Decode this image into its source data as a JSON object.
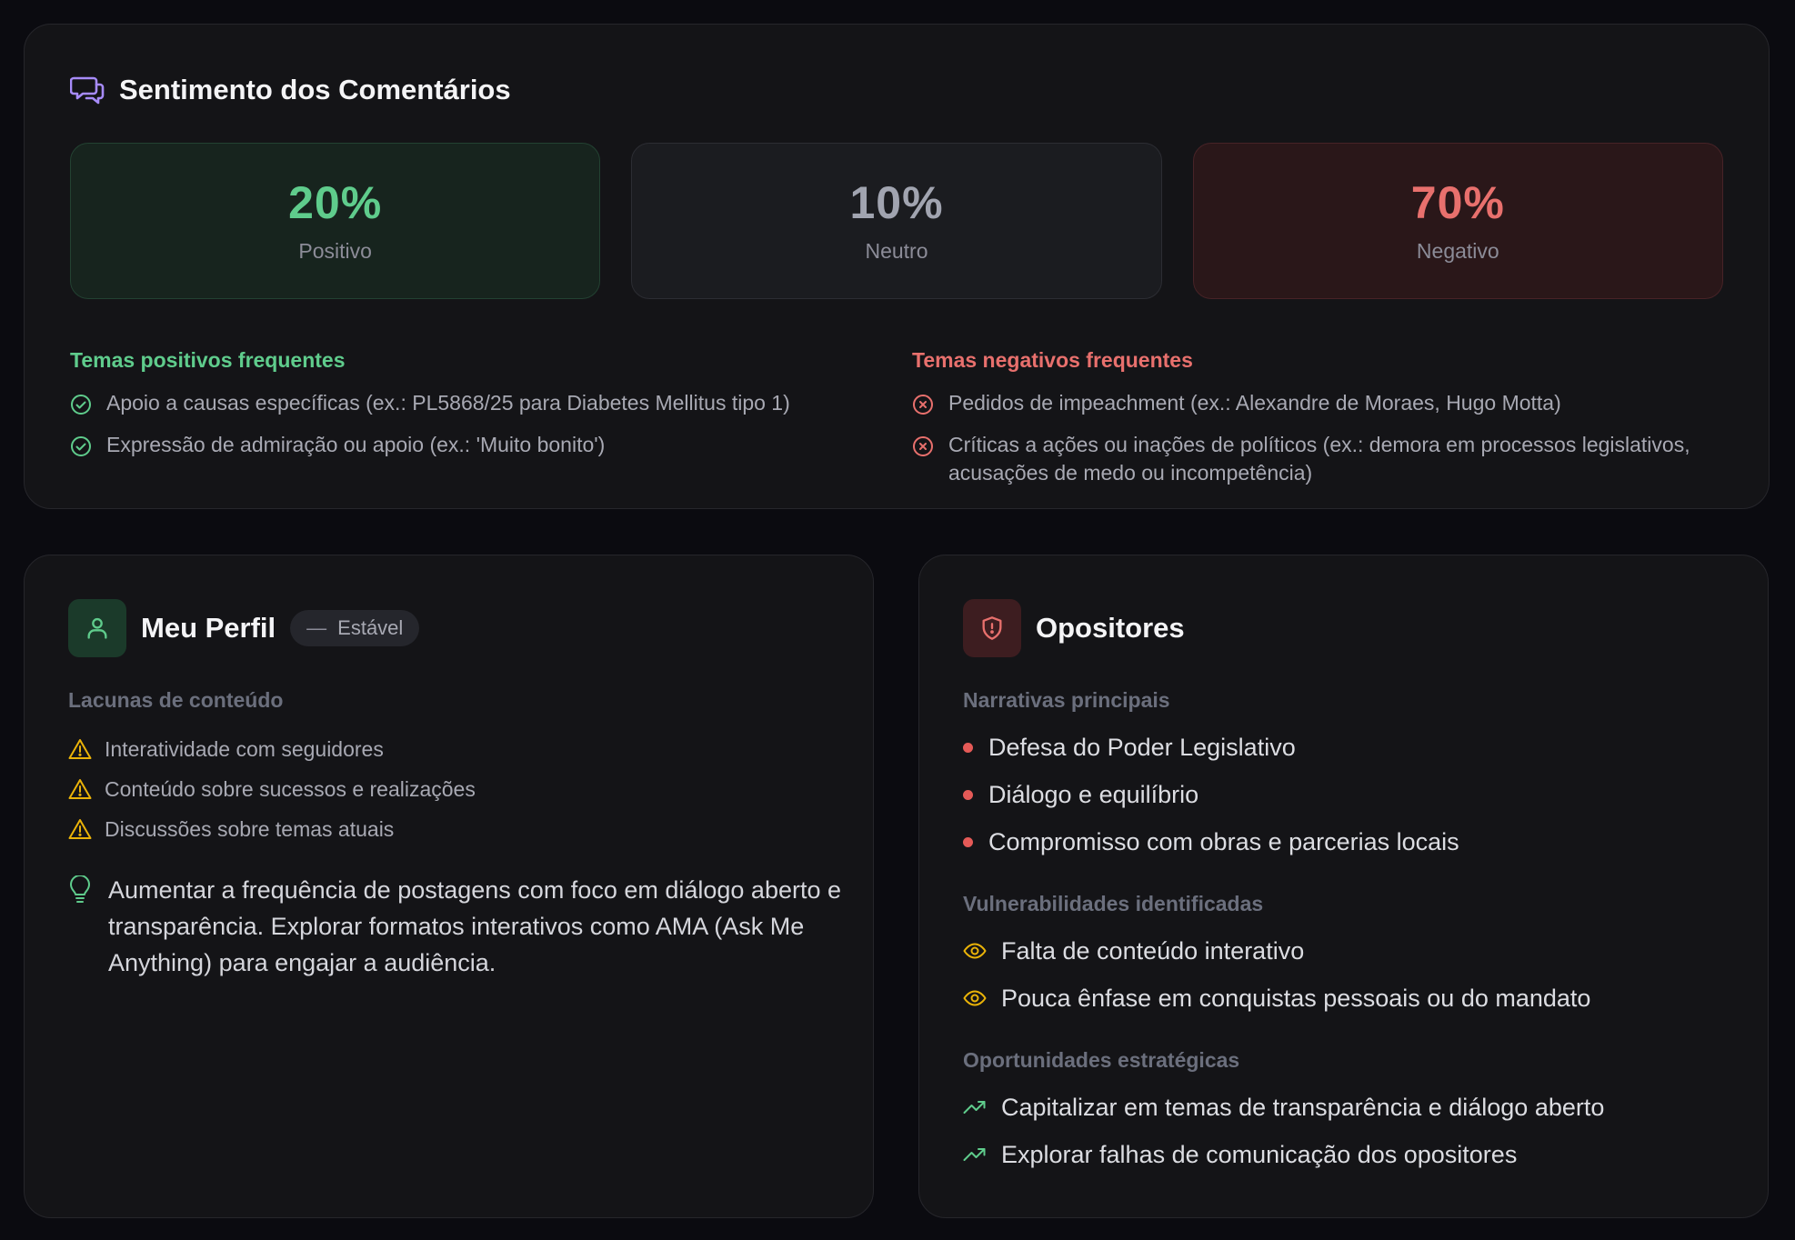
{
  "sentiment": {
    "title": "Sentimento dos Comentários",
    "stats": [
      {
        "value": "20%",
        "label": "Positivo",
        "color": "#5fcc8c"
      },
      {
        "value": "10%",
        "label": "Neutro",
        "color": "#a1a4b0"
      },
      {
        "value": "70%",
        "label": "Negativo",
        "color": "#e8706d"
      }
    ],
    "positive_themes": {
      "title": "Temas positivos frequentes",
      "items": [
        "Apoio a causas específicas (ex.: PL5868/25 para Diabetes Mellitus tipo 1)",
        "Expressão de admiração ou apoio (ex.: 'Muito bonito')"
      ]
    },
    "negative_themes": {
      "title": "Temas negativos frequentes",
      "items": [
        "Pedidos de impeachment (ex.: Alexandre de Moraes, Hugo Motta)",
        "Críticas a ações ou inações de políticos (ex.: demora em processos legislativos, acusações de medo ou incompetência)"
      ]
    }
  },
  "profile": {
    "title": "Meu Perfil",
    "badge": "Estável",
    "gaps_label": "Lacunas de conteúdo",
    "gaps": [
      "Interatividade com seguidores",
      "Conteúdo sobre sucessos e realizações",
      "Discussões sobre temas atuais"
    ],
    "tip": "Aumentar a frequência de postagens com foco em diálogo aberto e transparência. Explorar formatos interativos como AMA (Ask Me Anything) para engajar a audiência."
  },
  "opponents": {
    "title": "Opositores",
    "narratives_label": "Narrativas principais",
    "narratives": [
      "Defesa do Poder Legislativo",
      "Diálogo e equilíbrio",
      "Compromisso com obras e parcerias locais"
    ],
    "vulnerabilities_label": "Vulnerabilidades identificadas",
    "vulnerabilities": [
      "Falta de conteúdo interativo",
      "Pouca ênfase em conquistas pessoais ou do mandato"
    ],
    "opportunities_label": "Oportunidades estratégicas",
    "opportunities": [
      "Capitalizar em temas de transparência e diálogo aberto",
      "Explorar falhas de comunicação dos opositores"
    ]
  },
  "icons": {
    "sentiment": "chat-bubbles-icon",
    "positive": "check-circle-icon",
    "negative": "x-circle-icon",
    "profile": "user-icon",
    "gap": "warning-triangle-icon",
    "tip": "lightbulb-icon",
    "opponents": "shield-alert-icon",
    "vulnerability": "eye-icon",
    "opportunity": "trending-up-icon"
  }
}
